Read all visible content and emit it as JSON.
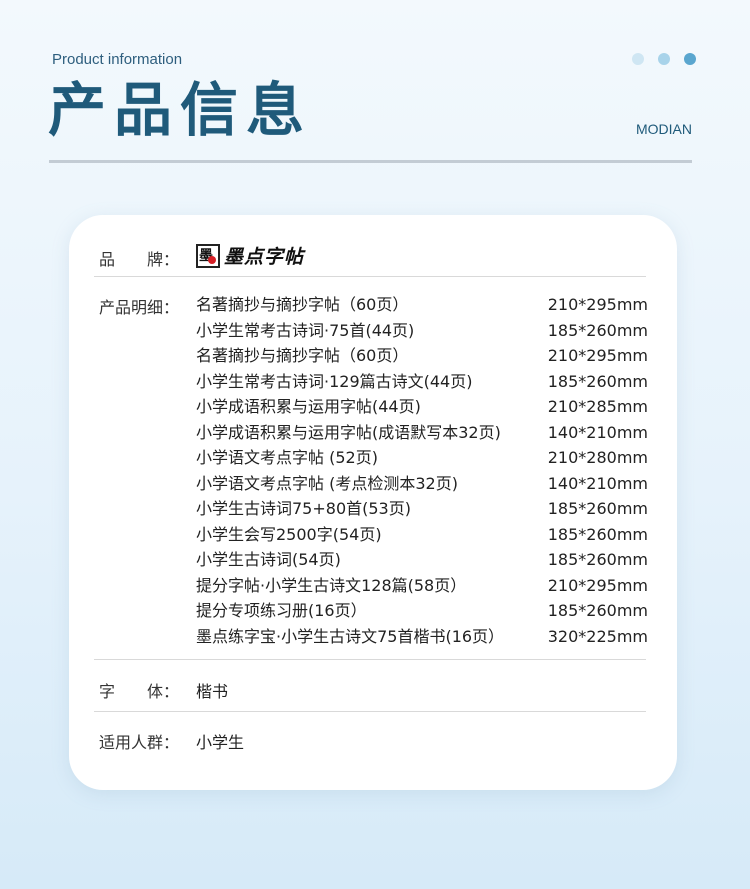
{
  "header": {
    "subtitle": "Product information",
    "title": "产品信息",
    "brand": "MODIAN"
  },
  "card": {
    "brand_label": "品　　牌：",
    "brand_name": "墨点字帖",
    "logo_text": "墨",
    "products_label": "产品明细：",
    "products": [
      {
        "name": "名著摘抄与摘抄字帖（60页）",
        "size": "210*295mm"
      },
      {
        "name": "小学生常考古诗词·75首(44页)",
        "size": "185*260mm"
      },
      {
        "name": "名著摘抄与摘抄字帖（60页）",
        "size": "210*295mm"
      },
      {
        "name": "小学生常考古诗词·129篇古诗文(44页)",
        "size": "185*260mm"
      },
      {
        "name": "小学成语积累与运用字帖(44页)",
        "size": "210*285mm"
      },
      {
        "name": "小学成语积累与运用字帖(成语默写本32页)",
        "size": "140*210mm"
      },
      {
        "name": "小学语文考点字帖 (52页)",
        "size": "210*280mm"
      },
      {
        "name": "小学语文考点字帖 (考点检测本32页)",
        "size": "140*210mm"
      },
      {
        "name": "小学生古诗词75+80首(53页)",
        "size": "185*260mm"
      },
      {
        "name": "小学生会写2500字(54页)",
        "size": "185*260mm"
      },
      {
        "name": "小学生古诗词(54页)",
        "size": "185*260mm"
      },
      {
        "name": "提分字帖·小学生古诗文128篇(58页）",
        "size": "210*295mm"
      },
      {
        "name": "提分专项练习册(16页）",
        "size": "185*260mm"
      },
      {
        "name": "墨点练字宝·小学生古诗文75首楷书(16页）",
        "size": "320*225mm"
      }
    ],
    "font_label": "字　　体：",
    "font_value": "楷书",
    "audience_label": "适用人群：",
    "audience_value": "小学生"
  }
}
